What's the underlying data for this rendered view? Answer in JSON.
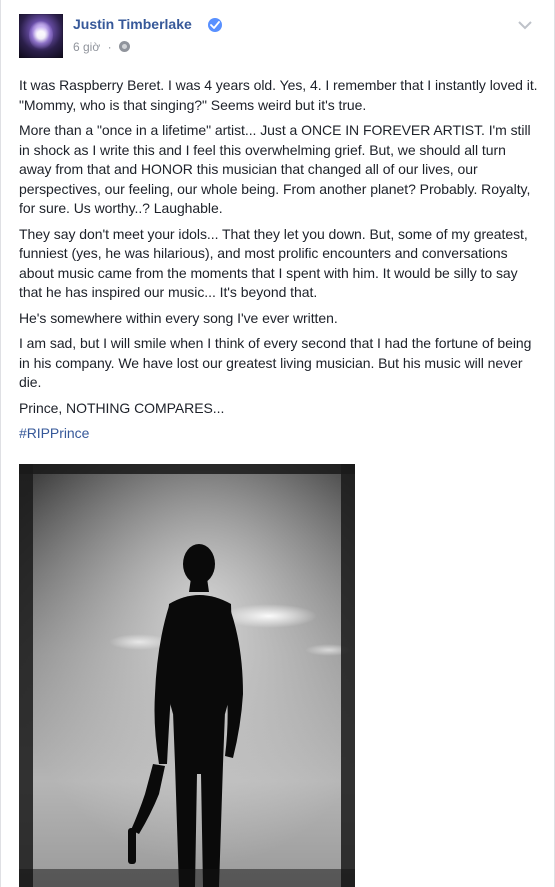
{
  "post": {
    "author": "Justin Timberlake",
    "verified_icon": "verified-badge-icon",
    "time": "6 giờ",
    "separator": "·",
    "privacy_icon": "globe-icon",
    "menu_icon": "chevron-down-icon",
    "paragraphs": [
      "It was Raspberry Beret. I was 4 years old. Yes, 4. I remember that I instantly loved it. \"Mommy, who is that singing?\" Seems weird but it's true.",
      "More than a \"once in a lifetime\" artist... Just a ONCE IN FOREVER ARTIST. I'm still in shock as I write this and I feel this overwhelming grief. But, we should all turn away from that and HONOR this musician that changed all of our lives, our perspectives, our feeling, our whole being. From another planet? Probably. Royalty, for sure. Us worthy..? Laughable.",
      "They say don't meet your idols... That they let you down. But, some of my greatest, funniest (yes, he was hilarious), and most prolific encounters and conversations about music came from the moments that I spent with him. It would be silly to say that he has inspired our music... It's beyond that.",
      "He's somewhere within every song I've ever written.",
      "I am sad, but I will smile when I think of every second that I had the fortune of being in his company. We have lost our greatest living musician. But his music will never die.",
      "Prince, NOTHING COMPARES..."
    ],
    "hashtag": "#RIPPrince",
    "colors": {
      "link": "#365899",
      "text": "#1d2129",
      "meta": "#90949c",
      "verified": "#5890ff"
    }
  }
}
